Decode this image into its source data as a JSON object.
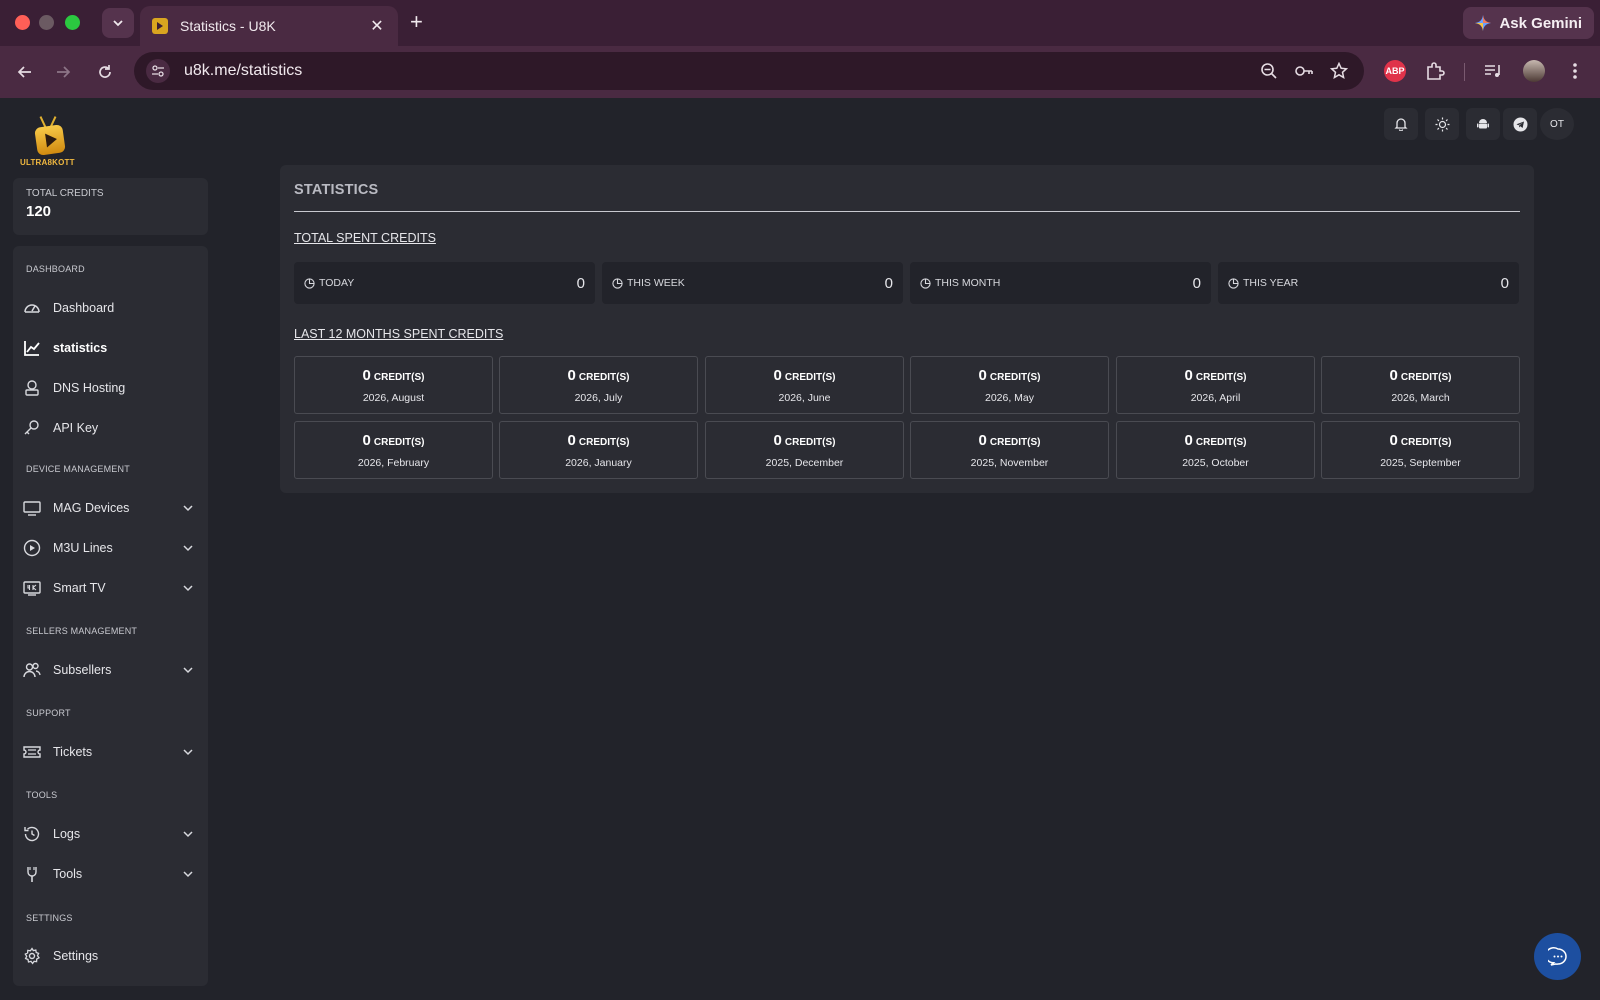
{
  "browser": {
    "tab_title": "Statistics - U8K",
    "url": "u8k.me/statistics",
    "gemini_label": "Ask Gemini",
    "abp_label": "ABP"
  },
  "brand": {
    "logo_text": "ULTRA8KOTT"
  },
  "credits": {
    "label": "TOTAL CREDITS",
    "value": "120"
  },
  "sidebar": {
    "sections": [
      {
        "label": "DASHBOARD"
      },
      {
        "label": "DEVICE MANAGEMENT"
      },
      {
        "label": "SELLERS MANAGEMENT"
      },
      {
        "label": "SUPPORT"
      },
      {
        "label": "TOOLS"
      },
      {
        "label": "SETTINGS"
      }
    ],
    "items": [
      {
        "label": "Dashboard",
        "icon": "gauge-icon"
      },
      {
        "label": "statistics",
        "icon": "chart-line-icon",
        "active": true
      },
      {
        "label": "DNS Hosting",
        "icon": "server-icon"
      },
      {
        "label": "API Key",
        "icon": "key-icon"
      },
      {
        "label": "MAG Devices",
        "icon": "monitor-icon",
        "expandable": true
      },
      {
        "label": "M3U Lines",
        "icon": "play-circle-icon",
        "expandable": true
      },
      {
        "label": "Smart TV",
        "icon": "tv-4k-icon",
        "expandable": true
      },
      {
        "label": "Subsellers",
        "icon": "users-icon",
        "expandable": true
      },
      {
        "label": "Tickets",
        "icon": "ticket-icon",
        "expandable": true
      },
      {
        "label": "Logs",
        "icon": "history-icon",
        "expandable": true
      },
      {
        "label": "Tools",
        "icon": "tools-icon",
        "expandable": true
      },
      {
        "label": "Settings",
        "icon": "gear-icon"
      }
    ]
  },
  "header": {
    "avatar_initials": "OT"
  },
  "statistics": {
    "title": "STATISTICS",
    "total_spent_title": "TOTAL SPENT CREDITS",
    "totals": [
      {
        "label": "TODAY",
        "value": "0"
      },
      {
        "label": "THIS WEEK",
        "value": "0"
      },
      {
        "label": "THIS MONTH",
        "value": "0"
      },
      {
        "label": "THIS YEAR",
        "value": "0"
      }
    ],
    "months_title": "LAST 12 MONTHS SPENT CREDITS",
    "unit": "CREDIT(S)",
    "months": [
      {
        "value": "0",
        "label": "2026, August"
      },
      {
        "value": "0",
        "label": "2026, July"
      },
      {
        "value": "0",
        "label": "2026, June"
      },
      {
        "value": "0",
        "label": "2026, May"
      },
      {
        "value": "0",
        "label": "2026, April"
      },
      {
        "value": "0",
        "label": "2026, March"
      },
      {
        "value": "0",
        "label": "2026, February"
      },
      {
        "value": "0",
        "label": "2026, January"
      },
      {
        "value": "0",
        "label": "2025, December"
      },
      {
        "value": "0",
        "label": "2025, November"
      },
      {
        "value": "0",
        "label": "2025, October"
      },
      {
        "value": "0",
        "label": "2025, September"
      }
    ]
  },
  "colors": {
    "accent": "#1d4fa0",
    "background": "#22232a",
    "card": "#2b2c33",
    "tab_bar": "#3a1f35"
  }
}
